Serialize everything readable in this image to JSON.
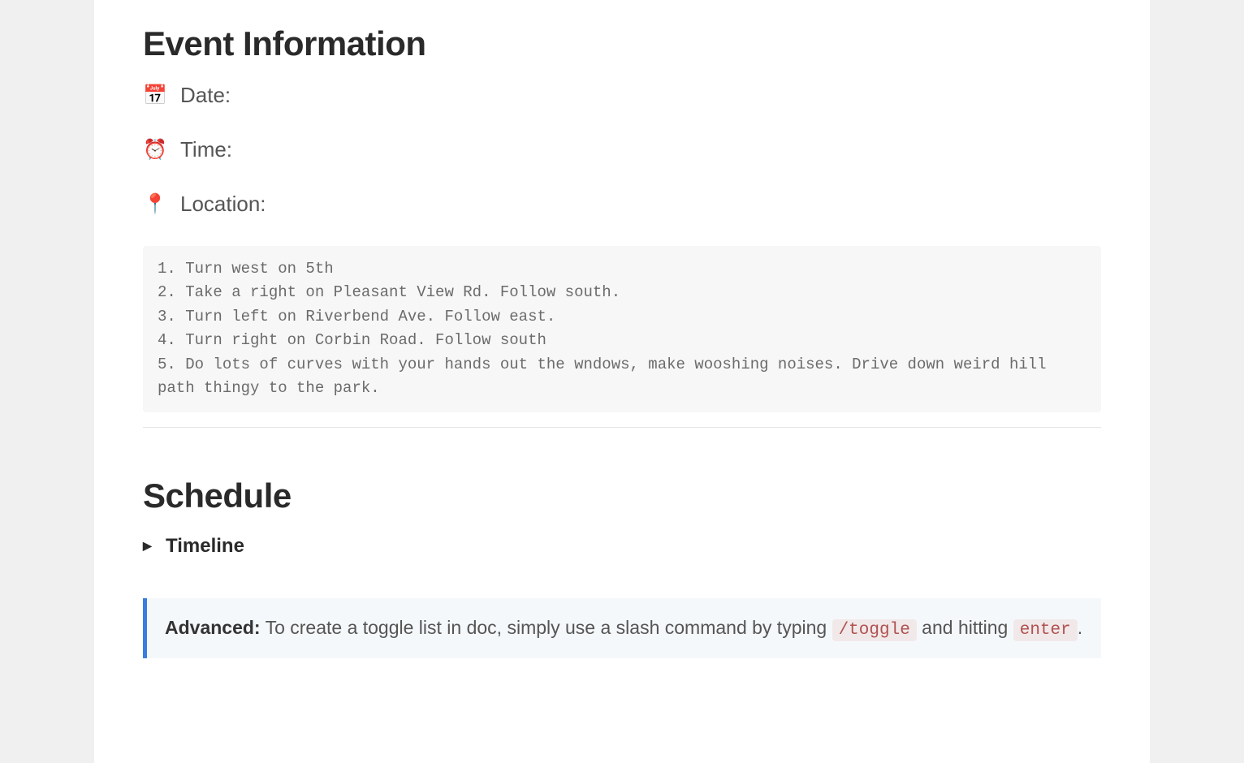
{
  "event_info": {
    "heading": "Event Information",
    "fields": {
      "date": {
        "icon": "📅",
        "label": "Date:"
      },
      "time": {
        "icon": "⏰",
        "label": "Time:"
      },
      "location": {
        "icon": "📍",
        "label": "Location:"
      }
    },
    "directions": "1. Turn west on 5th\n2. Take a right on Pleasant View Rd. Follow south.\n3. Turn left on Riverbend Ave. Follow east.\n4. Turn right on Corbin Road. Follow south\n5. Do lots of curves with your hands out the wndows, make wooshing noises. Drive down weird hill path thingy to the park."
  },
  "schedule": {
    "heading": "Schedule",
    "toggle_label": "Timeline",
    "callout": {
      "bold_label": "Advanced:",
      "text_before": " To create a toggle list in doc, simply use a slash command by typing ",
      "code1": "/toggle",
      "text_middle": " and hitting ",
      "code2": "enter",
      "text_after": "."
    }
  }
}
